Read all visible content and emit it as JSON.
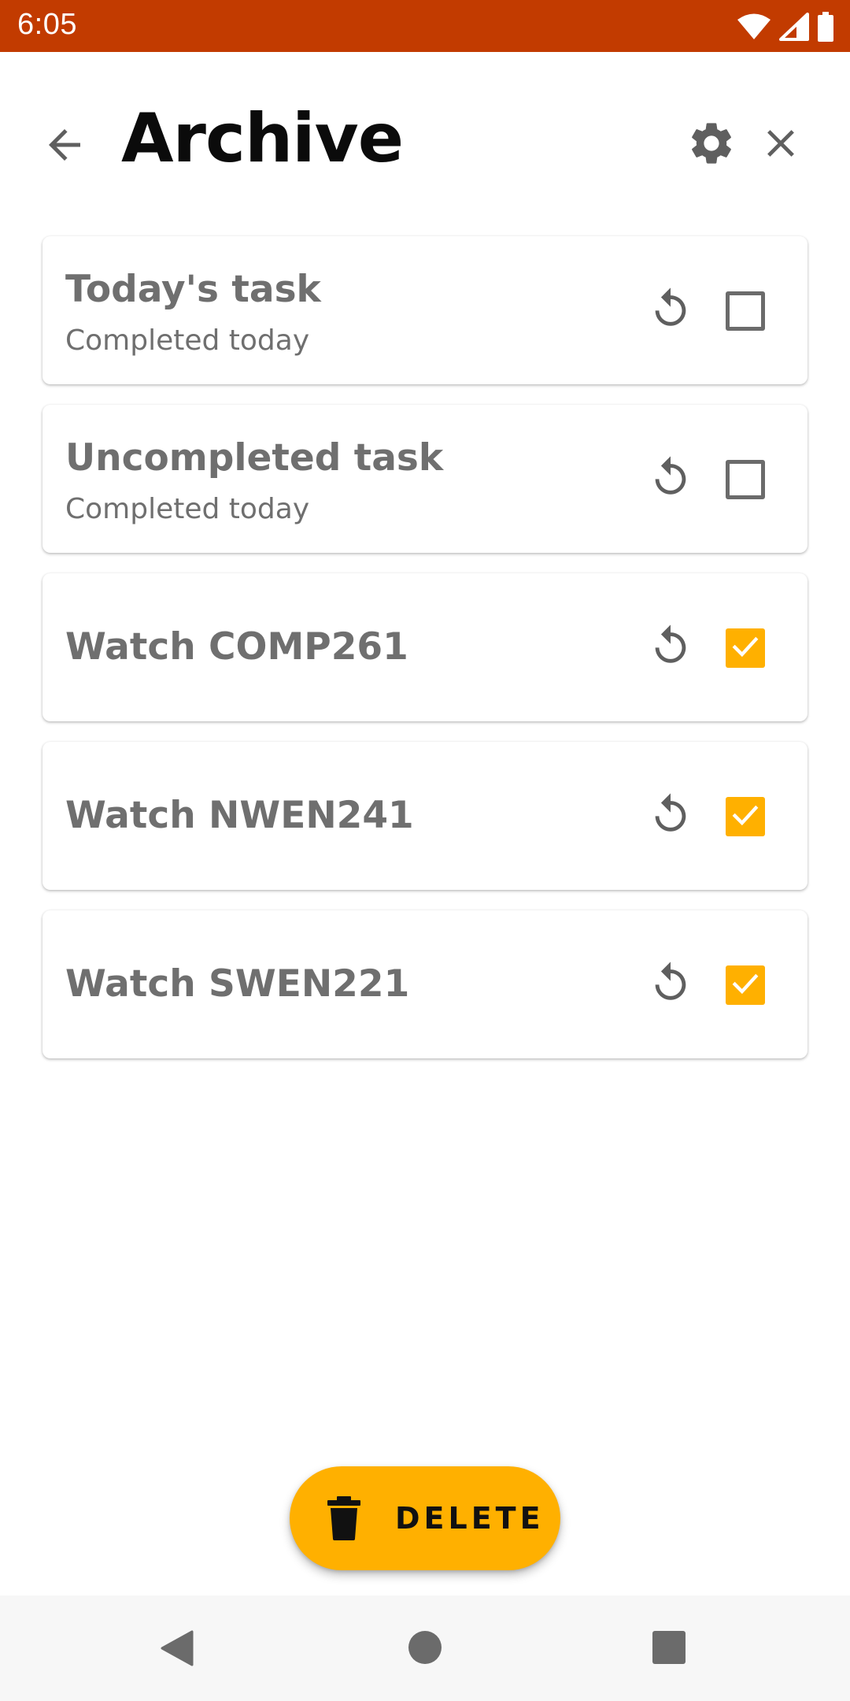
{
  "status_bar": {
    "time": "6:05",
    "background_color": "#c23b00",
    "icons": [
      "wifi-icon",
      "cellular-signal-icon",
      "battery-icon"
    ]
  },
  "header": {
    "back_icon": "arrow-back-icon",
    "title": "Archive",
    "settings_icon": "gear-icon",
    "close_icon": "close-icon"
  },
  "tasks": [
    {
      "title": "Today's task",
      "subtitle": "Completed today",
      "checked": false
    },
    {
      "title": "Uncompleted task",
      "subtitle": "Completed today",
      "checked": false
    },
    {
      "title": "Watch COMP261",
      "subtitle": "",
      "checked": true
    },
    {
      "title": "Watch NWEN241",
      "subtitle": "",
      "checked": true
    },
    {
      "title": "Watch SWEN221",
      "subtitle": "",
      "checked": true
    }
  ],
  "task_icons": {
    "restore": "restore-icon",
    "checkbox": "checkbox-icon"
  },
  "fab": {
    "label": "DELETE",
    "icon": "trash-icon",
    "color": "#ffb000"
  },
  "colors": {
    "accent": "#ffb000",
    "status_bar": "#c23b00",
    "text_muted": "#6f6f6f"
  },
  "nav_bar": {
    "icons": [
      "nav-back-icon",
      "nav-home-icon",
      "nav-recents-icon"
    ]
  }
}
